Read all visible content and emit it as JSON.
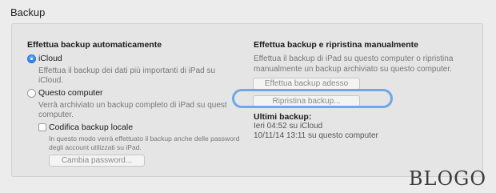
{
  "section": {
    "title": "Backup"
  },
  "auto": {
    "title": "Effettua backup automaticamente",
    "icloud": {
      "label": "iCloud",
      "desc_line1": "Effettua il backup dei dati più importanti di iPad su",
      "desc_line2": "iCloud."
    },
    "computer": {
      "label": "Questo computer",
      "desc_line1": "Verrà archiviato un backup completo di iPad su quest",
      "desc_line2": "computer."
    },
    "encrypt": {
      "label": "Codifica backup locale",
      "desc_line1": "In questo modo verrà effettuato il backup anche delle password",
      "desc_line2": "degli account utilizzati su iPad.",
      "change_password": "Cambia password..."
    }
  },
  "manual": {
    "title": "Effettua backup e ripristina manualmente",
    "desc_line1": "Effettua il backup di iPad su questo computer o ripristina",
    "desc_line2": "manualmente un backup archiviato su questo computer.",
    "backup_now": "Effettua backup adesso",
    "restore": "Ripristina backup..."
  },
  "last_backup": {
    "title": "Ultimi backup:",
    "line1": "Ieri 04:52 su iCloud",
    "line2": "10/11/14 13:11 su questo computer"
  },
  "watermark": "BLOGO",
  "colors": {
    "accent": "#2c7df0",
    "highlight": "#6ea8e6",
    "background": "#ececec",
    "panel": "#e5e5e5"
  }
}
